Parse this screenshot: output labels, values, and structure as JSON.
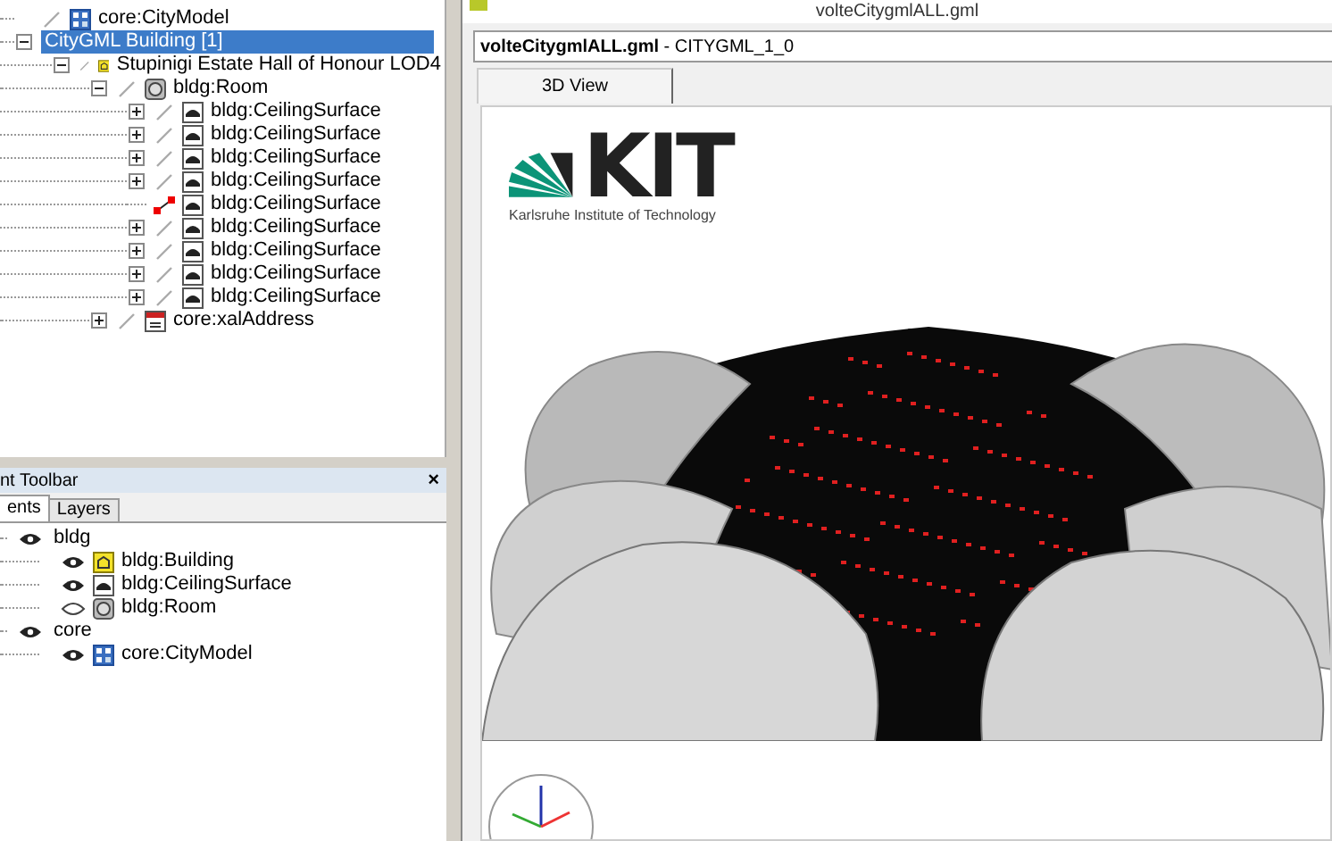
{
  "model_tree": [
    {
      "label": "core:CityModel",
      "kind": "model",
      "selected": false,
      "highlighted": false
    },
    {
      "label": "CityGML Building [1]",
      "expanded": true,
      "selected": true,
      "children": [
        {
          "label": "Stupinigi Estate Hall of Honour LOD4",
          "kind": "building",
          "expanded": true,
          "selected": false,
          "highlighted": false,
          "children": [
            {
              "label": "bldg:Room",
              "kind": "room",
              "expanded": true,
              "selected": false,
              "highlighted": false,
              "children": [
                {
                  "label": "bldg:CeilingSurface",
                  "kind": "surface",
                  "expanded": false,
                  "selected": false,
                  "highlighted": false
                },
                {
                  "label": "bldg:CeilingSurface",
                  "kind": "surface",
                  "expanded": false,
                  "selected": false,
                  "highlighted": false
                },
                {
                  "label": "bldg:CeilingSurface",
                  "kind": "surface",
                  "expanded": false,
                  "selected": false,
                  "highlighted": false
                },
                {
                  "label": "bldg:CeilingSurface",
                  "kind": "surface",
                  "expanded": false,
                  "selected": false,
                  "highlighted": false
                },
                {
                  "label": "bldg:CeilingSurface",
                  "kind": "surface",
                  "selected": false,
                  "highlighted": true
                },
                {
                  "label": "bldg:CeilingSurface",
                  "kind": "surface",
                  "expanded": false,
                  "selected": false,
                  "highlighted": false
                },
                {
                  "label": "bldg:CeilingSurface",
                  "kind": "surface",
                  "expanded": false,
                  "selected": false,
                  "highlighted": false
                },
                {
                  "label": "bldg:CeilingSurface",
                  "kind": "surface",
                  "expanded": false,
                  "selected": false,
                  "highlighted": false
                },
                {
                  "label": "bldg:CeilingSurface",
                  "kind": "surface",
                  "expanded": false,
                  "selected": false,
                  "highlighted": false
                }
              ]
            },
            {
              "label": "core:xalAddress",
              "kind": "address",
              "expanded": false,
              "selected": false,
              "highlighted": false
            }
          ]
        }
      ]
    }
  ],
  "toolbar": {
    "title": "nt Toolbar",
    "close": "×",
    "tabs": [
      {
        "label": "ents",
        "selected": true
      },
      {
        "label": "Layers",
        "selected": false
      }
    ],
    "layers": [
      {
        "label": "bldg",
        "visible": true,
        "children": [
          {
            "label": "bldg:Building",
            "kind": "building",
            "visible": true
          },
          {
            "label": "bldg:CeilingSurface",
            "kind": "surface",
            "visible": true
          },
          {
            "label": "bldg:Room",
            "kind": "room",
            "visible": false
          }
        ]
      },
      {
        "label": "core",
        "visible": true,
        "children": [
          {
            "label": "core:CityModel",
            "kind": "model",
            "visible": true
          }
        ]
      }
    ]
  },
  "document": {
    "window_title": "volteCitygmlALL.gml",
    "file_name": "volteCitygmlALL.gml",
    "format": " - CITYGML_1_0",
    "tabs": [
      {
        "label": "3D View",
        "selected": true
      }
    ],
    "logo": {
      "letters": "KIT",
      "caption": "Karlsruhe Institute of Technology"
    }
  }
}
